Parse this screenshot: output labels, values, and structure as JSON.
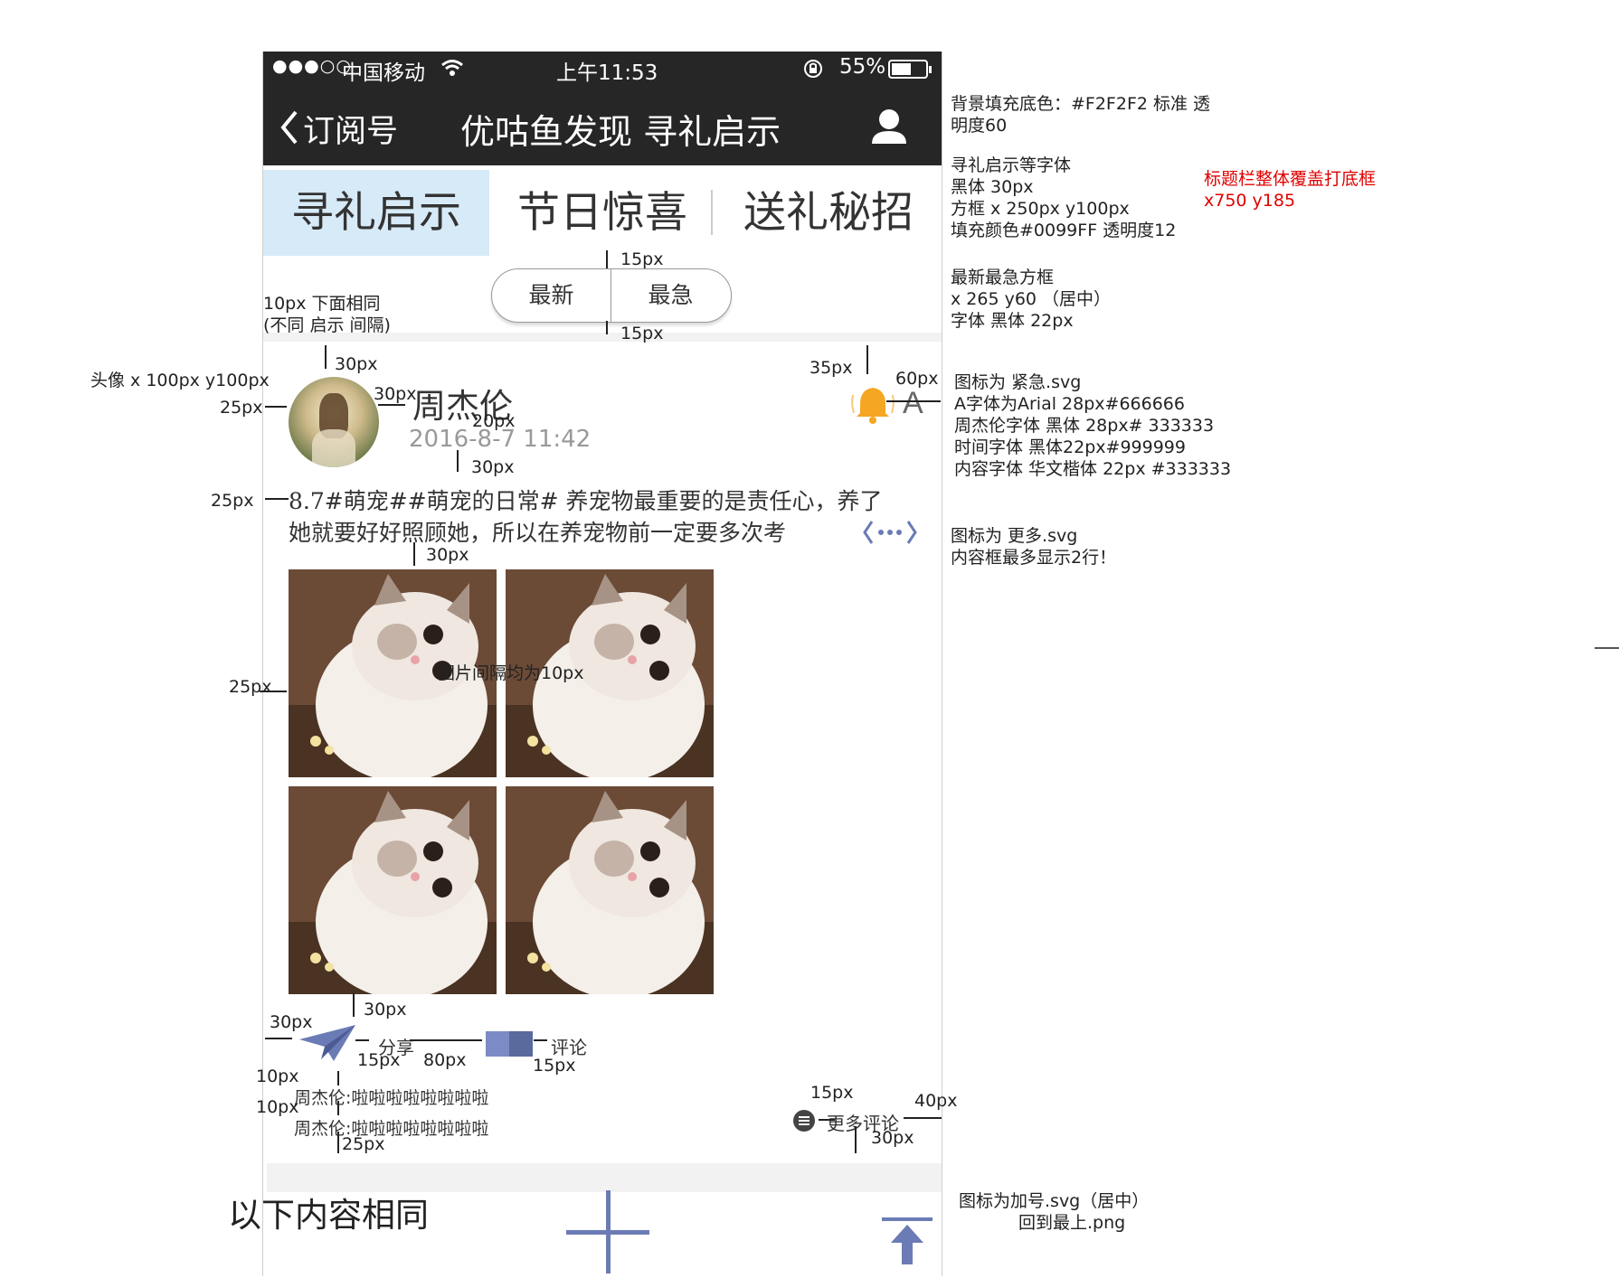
{
  "status_bar": {
    "signal": "●●●○○",
    "carrier": "中国移动",
    "time": "上午11:53",
    "battery": "55%"
  },
  "nav": {
    "back_label": "订阅号",
    "title": "优咕鱼发现 寻礼启示"
  },
  "tabs": [
    {
      "label": "寻礼启示",
      "active": true
    },
    {
      "label": "节日惊喜",
      "active": false
    },
    {
      "label": "送礼秘招",
      "active": false
    }
  ],
  "segment": {
    "left": "最新",
    "right": "最急"
  },
  "post": {
    "author": "周杰伦",
    "time": "2016-8-7  11:42",
    "urgent_letter": "A",
    "content_line1": "8.7#萌宠##萌宠的日常# 养宠物最重要的是责任心，养了",
    "content_line2": "她就要好好照顾她，所以在养宠物前一定要多次考",
    "images_note": "图片间隔均为10px",
    "share_label": "分享",
    "comment_label": "评论",
    "comments": [
      "周杰伦:啦啦啦啦啦啦啦啦",
      "周杰伦:啦啦啦啦啦啦啦啦"
    ],
    "more_comments": "更多评论"
  },
  "bottom_note": "以下内容相同",
  "annotations": {
    "bg": [
      "背景填充底色：#F2F2F2 标准 透",
      "明度60"
    ],
    "tab_font": [
      "寻礼启示等字体",
      "黑体 30px",
      "方框 x 250px y100px",
      "填充颜色#0099FF 透明度12"
    ],
    "title_bar": [
      "标题栏整体覆盖打底框",
      "x750 y185"
    ],
    "segment_box": [
      "最新最急方框",
      "x 265 y60 （居中）",
      "字体 黑体 22px"
    ],
    "icons": [
      "图标为 紧急.svg",
      "A字体为Arial 28px#666666",
      "周杰伦字体 黑体 28px# 333333",
      "时间字体 黑体22px#999999",
      "内容字体 华文楷体 22px #333333"
    ],
    "more": [
      "图标为 更多.svg",
      "内容框最多显示2行！"
    ],
    "plus": [
      "图标为加号.svg（居中）",
      "回到最上.png"
    ],
    "avatar": "头像 x 100px y100px",
    "gap10": [
      "10px 下面相同",
      "(不同 启示 间隔)"
    ],
    "px15a": "15px",
    "px15b": "15px",
    "px30a": "30px",
    "px35": "35px",
    "px60": "60px",
    "px25a": "25px",
    "px30b": "30px",
    "px20": "20px",
    "px30c": "30px",
    "px25b": "25px",
    "px30d": "30px",
    "px25c": "25px",
    "px30e": "30px",
    "px30f": "30px",
    "px15c": "15px",
    "px80": "80px",
    "px15d": "15px",
    "px10a": "10px",
    "px10b": "10px",
    "px25d": "25px",
    "px15e": "15px",
    "px40": "40px",
    "px30g": "30px"
  },
  "colors": {
    "dark_bar": "#262626",
    "tab_active": "#D7EAF7",
    "icon_blue": "#6B7BB5",
    "bell": "#F5A623"
  },
  "icons": [
    "wifi-icon",
    "lock-rotation-icon",
    "battery-icon",
    "back-chevron-icon",
    "user-icon",
    "bell-icon",
    "more-icon",
    "paper-plane-icon",
    "comment-book-icon",
    "menu-circle-icon",
    "plus-icon",
    "back-to-top-icon"
  ]
}
